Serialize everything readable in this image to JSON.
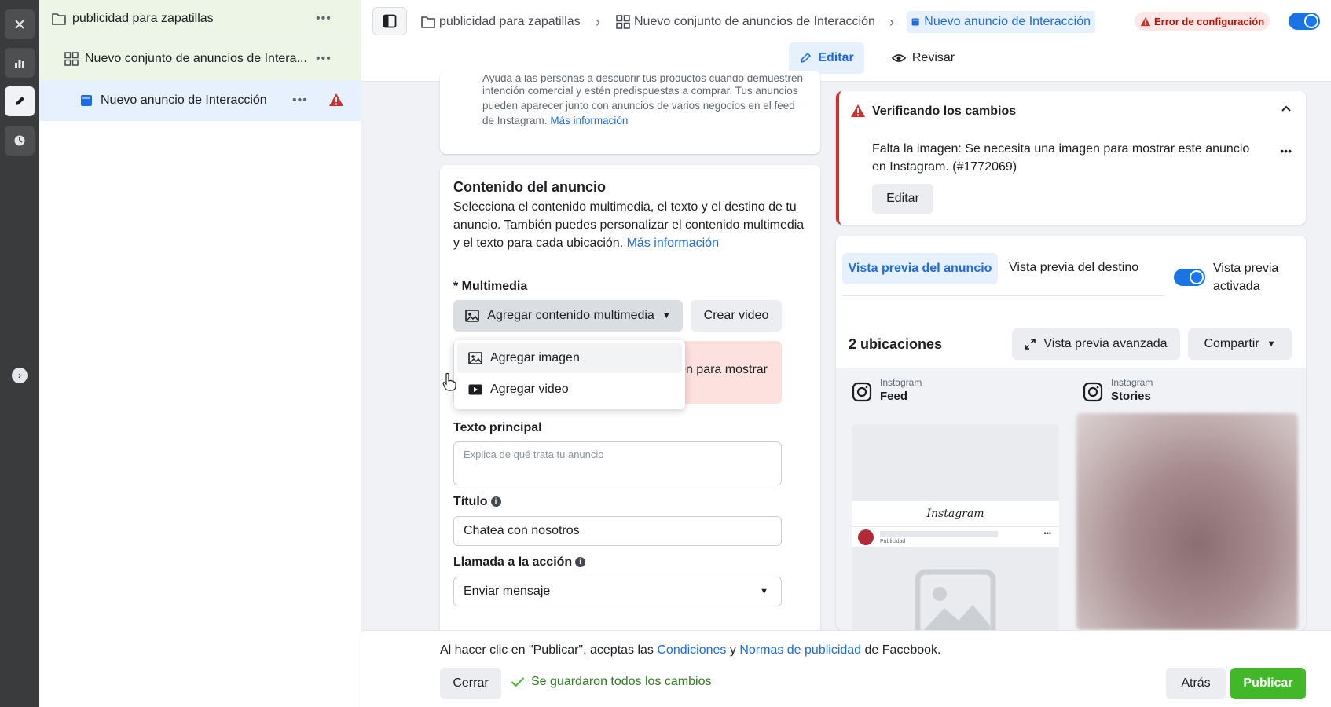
{
  "rail": {
    "icons": [
      "close-icon",
      "chart-icon",
      "pencil-icon",
      "clock-icon",
      "chevron-right-icon"
    ]
  },
  "tree": {
    "campaign": "publicidad para zapatillas",
    "adset": "Nuevo conjunto de anuncios de Intera...",
    "ad": "Nuevo anuncio de Interacción",
    "more": "•••"
  },
  "breadcrumb": {
    "campaign": "publicidad para zapatillas",
    "adset": "Nuevo conjunto de anuncios de Interacción",
    "ad": "Nuevo anuncio de Interacción",
    "sep": "›"
  },
  "header": {
    "error_badge": "Error de configuración",
    "tab_edit": "Editar",
    "tab_review": "Revisar"
  },
  "top_card": {
    "line0": "Ayuda a las personas a descubrir tus productos cuando demuestren",
    "line1": "intención comercial y estén predispuestas a comprar. Tus anuncios",
    "line2": "pueden aparecer junto con anuncios de varios negocios en el feed",
    "line3": "de Instagram.",
    "link": "Más información"
  },
  "content": {
    "title": "Contenido del anuncio",
    "desc1": "Selecciona el contenido multimedia, el texto y el destino de tu",
    "desc2": "anuncio. También puedes personalizar el contenido multimedia",
    "desc3": "y el texto para cada ubicación.",
    "desc_link": "Más información",
    "multimedia_label": "* Multimedia",
    "add_media": "Agregar contenido multimedia",
    "create_video": "Crear video",
    "menu_image": "Agregar imagen",
    "menu_video": "Agregar video",
    "error_partial": "agen para mostrar",
    "primary_text_label": "Texto principal",
    "primary_text_placeholder": "Explica de qué trata tu anuncio",
    "title_label": "Título",
    "title_value": "Chatea con nosotros",
    "cta_label": "Llamada a la acción",
    "cta_value": "Enviar mensaje"
  },
  "verify": {
    "title": "Verificando los cambios",
    "msg1": "Falta la imagen: Se necesita una imagen para mostrar este anuncio",
    "msg2": "en Instagram. (#1772069)",
    "edit": "Editar",
    "more": "•••"
  },
  "preview": {
    "tab_ad": "Vista previa del anuncio",
    "tab_dest": "Vista previa del destino",
    "toggle_label1": "Vista previa",
    "toggle_label2": "activada",
    "placements": "2 ubicaciones",
    "advanced": "Vista previa avanzada",
    "share": "Compartir",
    "feed_platform": "Instagram",
    "feed_name": "Feed",
    "stories_platform": "Instagram",
    "stories_name": "Stories",
    "ig_logo": "Instagram",
    "sponsored": "Publicidad"
  },
  "footer": {
    "terms_pre": "Al hacer clic en \"Publicar\", aceptas las ",
    "terms_link1": "Condiciones",
    "terms_mid": " y ",
    "terms_link2": "Normas de publicidad",
    "terms_post": " de Facebook.",
    "close": "Cerrar",
    "saved": "Se guardaron todos los cambios",
    "back": "Atrás",
    "publish": "Publicar"
  },
  "colors": {
    "accent": "#1b6ce6",
    "error": "#d0302c",
    "success": "#42b72a"
  }
}
